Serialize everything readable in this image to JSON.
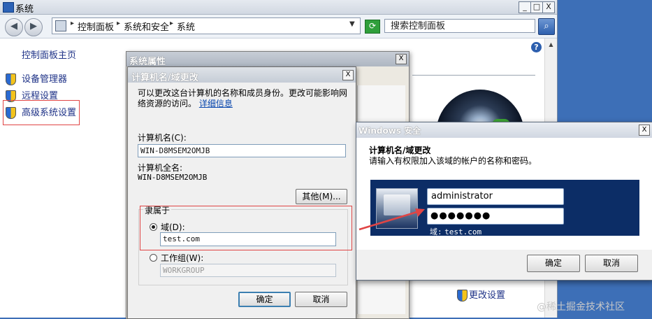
{
  "main_window": {
    "title": "系统",
    "controls": {
      "minimize": "_",
      "maximize": "□",
      "close": "X"
    },
    "nav": {
      "back": "◀",
      "forward": "▶"
    },
    "breadcrumb": [
      "控制面板",
      "系统和安全",
      "系统"
    ],
    "search_placeholder": "搜索控制面板",
    "sidebar": {
      "home": "控制面板主页",
      "items": [
        {
          "label": "设备管理器",
          "icon": "shield-icon"
        },
        {
          "label": "远程设置",
          "icon": "shield-icon"
        },
        {
          "label": "高级系统设置",
          "icon": "shield-icon"
        }
      ]
    },
    "help": "?",
    "change_settings": "更改设置"
  },
  "system_properties": {
    "title": "系统属性",
    "close": "X"
  },
  "computer_name_dialog": {
    "title": "计算机名/域更改",
    "close": "X",
    "description": "可以更改这台计算机的名称和成员身份。更改可能影响网络资源的访问。",
    "details_link": "详细信息",
    "computer_name_label": "计算机名(C):",
    "computer_name_value": "WIN-D8MSEM2OMJB",
    "full_name_label": "计算机全名:",
    "full_name_value": "WIN-D8MSEM2OMJB",
    "other_button": "其他(M)...",
    "member_of_label": "隶属于",
    "domain_label": "域(D):",
    "domain_value": "test.com",
    "workgroup_label": "工作组(W):",
    "workgroup_value": "WORKGROUP",
    "ok_button": "确定",
    "cancel_button": "取消"
  },
  "security_dialog": {
    "title": "Windows 安全",
    "close": "X",
    "heading": "计算机名/域更改",
    "subtitle": "请输入有权限加入该域的帐户的名称和密码。",
    "username": "administrator",
    "password": "●●●●●●●",
    "domain_prefix": "域:",
    "domain_value": "test.com",
    "ok_button": "确定",
    "cancel_button": "取消"
  },
  "watermark": "@稀土掘金技术社区",
  "colors": {
    "highlight": "#e04545",
    "credential_panel": "#0c2d66",
    "link": "#1e3287"
  }
}
